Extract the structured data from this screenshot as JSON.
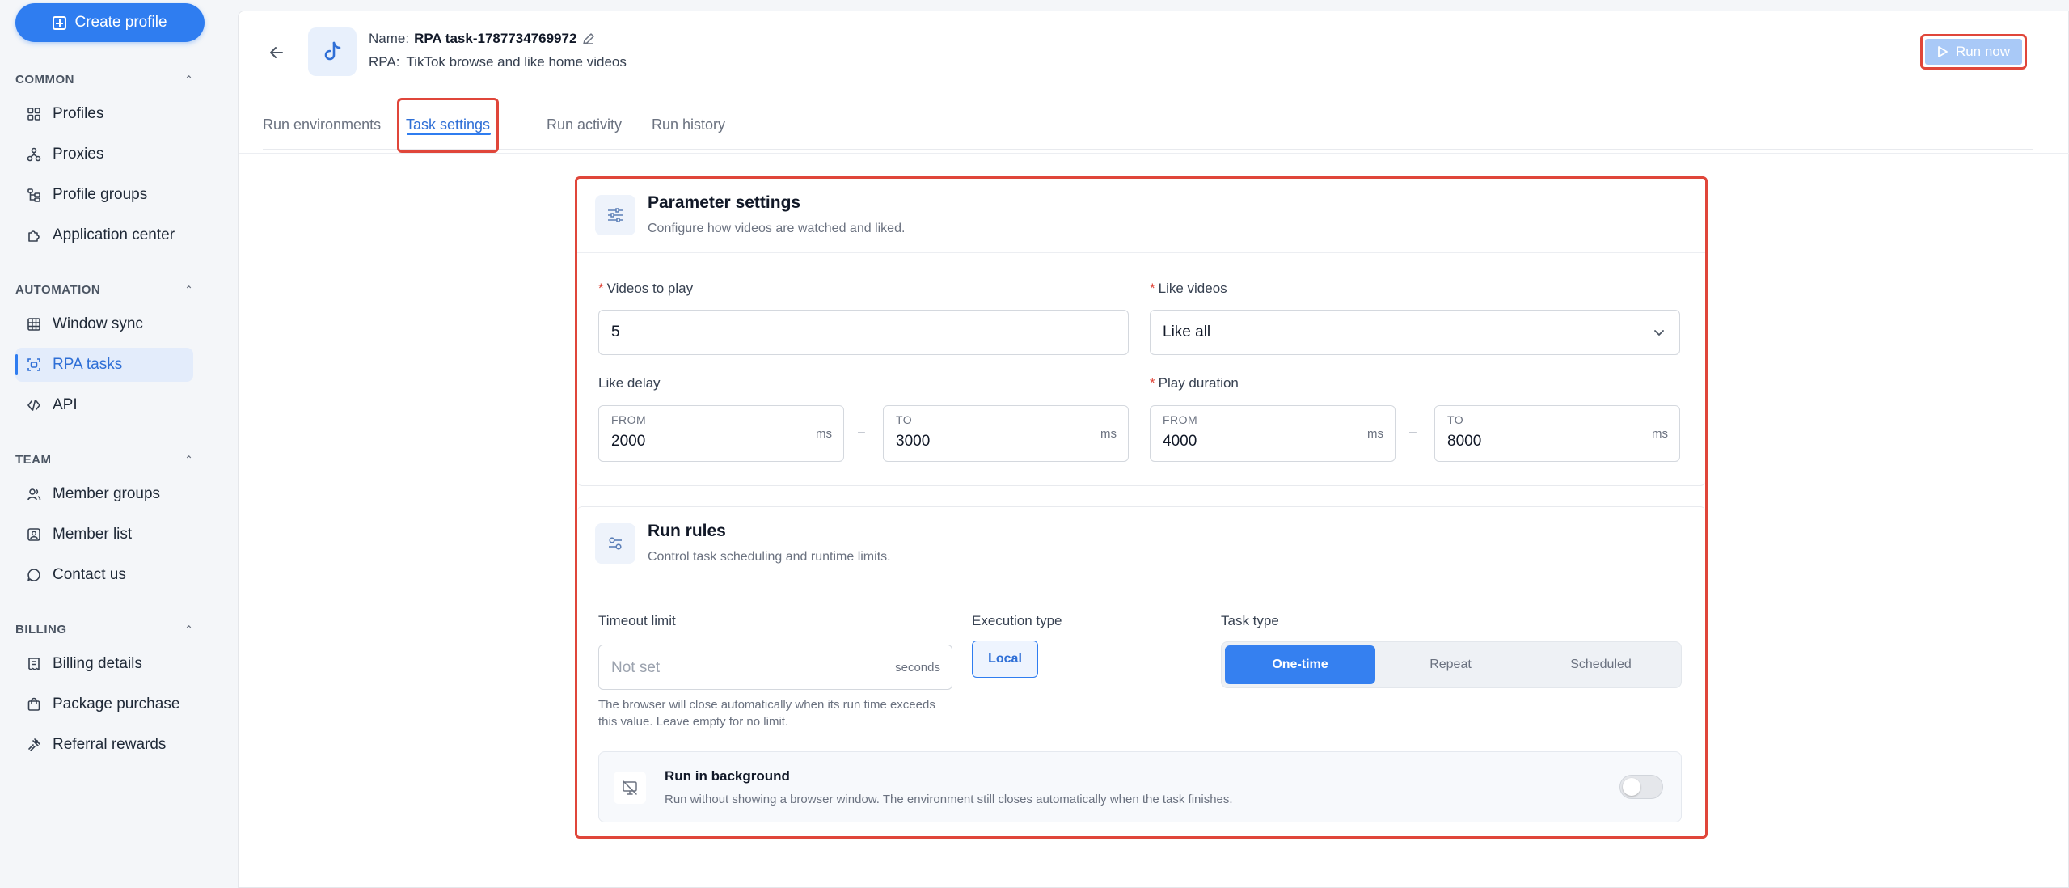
{
  "sidebar": {
    "create_label": "Create profile",
    "sections": {
      "common": "COMMON",
      "automation": "AUTOMATION",
      "team": "TEAM",
      "billing": "BILLING"
    },
    "items": {
      "profiles": "Profiles",
      "proxies": "Proxies",
      "profile_groups": "Profile groups",
      "application_center": "Application center",
      "window_sync": "Window sync",
      "rpa_tasks": "RPA tasks",
      "api": "API",
      "member_groups": "Member groups",
      "member_list": "Member list",
      "contact_us": "Contact us",
      "billing_details": "Billing details",
      "package_purchase": "Package purchase",
      "referral_rewards": "Referral rewards"
    },
    "active_item": "rpa_tasks"
  },
  "header": {
    "name_label": "Name:",
    "name_value": "RPA task-1787734769972",
    "rpa_label": "RPA:",
    "rpa_value": "TikTok browse and like home videos",
    "run_now_label": "Run now"
  },
  "tabs": {
    "run_environments": "Run environments",
    "task_settings": "Task settings",
    "run_activity": "Run activity",
    "run_history": "Run history",
    "active": "task_settings"
  },
  "parameter_settings": {
    "title": "Parameter settings",
    "subtitle": "Configure how videos are watched and liked.",
    "videos_to_play_label": "Videos to play",
    "videos_to_play_value": "5",
    "like_videos_label": "Like videos",
    "like_videos_value": "Like all",
    "like_delay_label": "Like delay",
    "like_delay_from": "2000",
    "like_delay_to": "3000",
    "play_duration_label": "Play duration",
    "play_duration_from": "4000",
    "play_duration_to": "8000",
    "from_label": "FROM",
    "to_label": "TO",
    "unit_ms": "ms",
    "range_sep": "–"
  },
  "run_rules": {
    "title": "Run rules",
    "subtitle": "Control task scheduling and runtime limits.",
    "timeout_label": "Timeout limit",
    "timeout_placeholder": "Not set",
    "timeout_unit": "seconds",
    "timeout_hint": "The browser will close automatically when its run time exceeds this value. Leave empty for no limit.",
    "execution_type_label": "Execution type",
    "execution_type_value": "Local",
    "task_type_label": "Task type",
    "task_type_options": [
      "One-time",
      "Repeat",
      "Scheduled"
    ],
    "task_type_selected": "One-time",
    "background_title": "Run in background",
    "background_subtitle": "Run without showing a browser window. The environment still closes automatically when the task finishes.",
    "background_enabled": false
  },
  "colors": {
    "accent": "#2f7df0",
    "highlight_border": "#e0463a",
    "required": "#e0463a"
  }
}
